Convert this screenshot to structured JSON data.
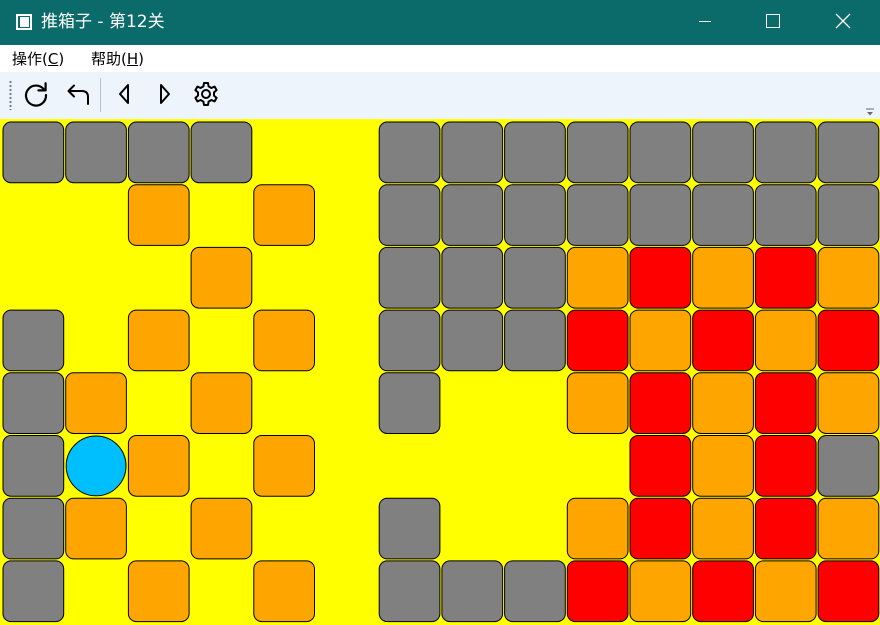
{
  "window": {
    "title": "推箱子 - 第12关",
    "colors": {
      "titlebar": "#0b6a6a",
      "title_text": "#ffffff"
    }
  },
  "window_controls": [
    {
      "name": "minimize-button",
      "icon": "minimize-icon"
    },
    {
      "name": "maximize-button",
      "icon": "maximize-icon"
    },
    {
      "name": "close-button",
      "icon": "close-icon"
    }
  ],
  "menu": [
    {
      "label": "操作",
      "mnemonic": "C"
    },
    {
      "label": "帮助",
      "mnemonic": "H"
    }
  ],
  "toolbar": {
    "buttons": [
      {
        "name": "restart-button",
        "icon": "refresh-icon"
      },
      {
        "name": "undo-button",
        "icon": "undo-icon"
      },
      {
        "name": "previous-level-button",
        "icon": "triangle-left-icon"
      },
      {
        "name": "next-level-button",
        "icon": "triangle-right-icon"
      },
      {
        "name": "settings-button",
        "icon": "gear-icon"
      }
    ]
  },
  "board": {
    "rows": 8,
    "cols": 14,
    "legend": {
      "W": "wall",
      "B": "box",
      "R": "box-on-goal",
      "P": "player",
      ".": "floor"
    },
    "colors": {
      "floor": "#ffff00",
      "wall": "#808080",
      "box": "#ffa500",
      "box_on_goal": "#ff0000",
      "player": "#00bfff",
      "outline": "#000000"
    },
    "grid": [
      "WWWW..WWWWWWWW",
      "..B.B.WWWWWWWW",
      "...B..WWWBRBRB",
      "W.B.B.WWWRBRBR",
      "WB.B..W..BRBRB",
      "WPB.B.....RBRW",
      "WB.B..W..BRBRB",
      "W.B.B.WWWRBRBR"
    ]
  }
}
